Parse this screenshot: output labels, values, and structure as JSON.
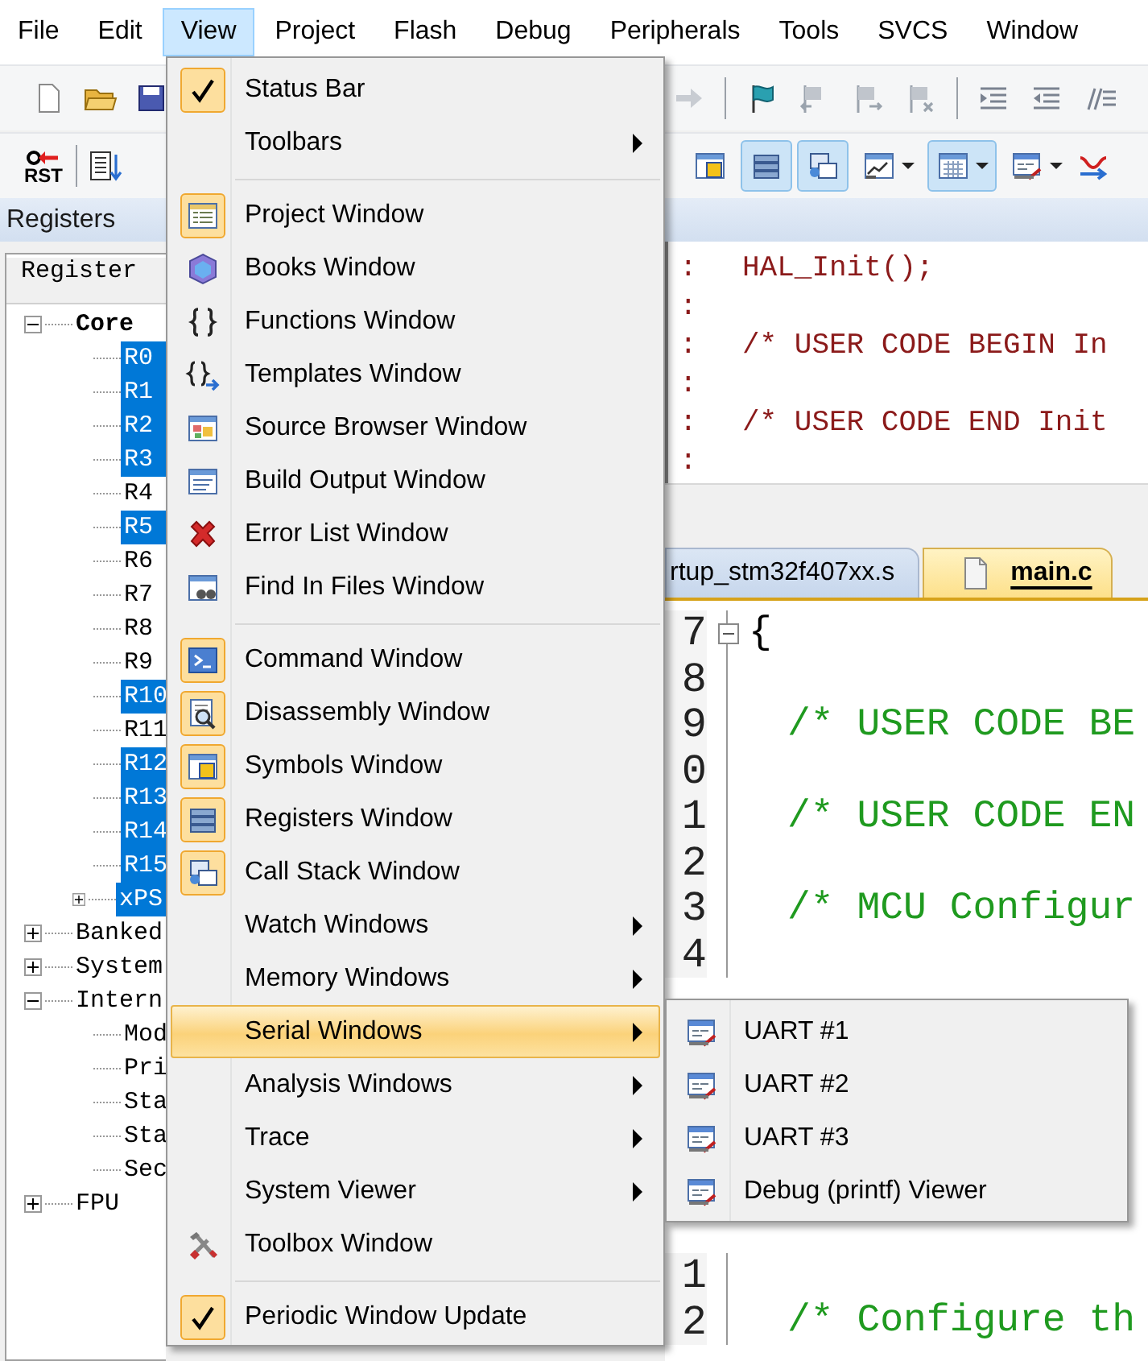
{
  "menubar": [
    {
      "label": "File",
      "selected": false
    },
    {
      "label": "Edit",
      "selected": false
    },
    {
      "label": "View",
      "selected": true
    },
    {
      "label": "Project",
      "selected": false
    },
    {
      "label": "Flash",
      "selected": false
    },
    {
      "label": "Debug",
      "selected": false
    },
    {
      "label": "Peripherals",
      "selected": false
    },
    {
      "label": "Tools",
      "selected": false
    },
    {
      "label": "SVCS",
      "selected": false
    },
    {
      "label": "Window",
      "selected": false
    }
  ],
  "debug_toolbar": {
    "reset_label": "RST",
    "buttons": [
      {
        "on": false
      },
      {
        "on": true
      },
      {
        "on": true
      },
      {
        "on": false
      },
      {
        "on": true
      },
      {
        "on": false
      }
    ]
  },
  "registers": {
    "title": "Registers",
    "column": "Register",
    "tree": [
      {
        "label": "Core",
        "bold": true,
        "expanded": true,
        "selected": false,
        "children": [
          {
            "label": "R0",
            "selected": true
          },
          {
            "label": "R1",
            "selected": true
          },
          {
            "label": "R2",
            "selected": true
          },
          {
            "label": "R3",
            "selected": true
          },
          {
            "label": "R4",
            "selected": false
          },
          {
            "label": "R5",
            "selected": true
          },
          {
            "label": "R6",
            "selected": false
          },
          {
            "label": "R7",
            "selected": false
          },
          {
            "label": "R8",
            "selected": false
          },
          {
            "label": "R9",
            "selected": false
          },
          {
            "label": "R10",
            "selected": true
          },
          {
            "label": "R11",
            "selected": false
          },
          {
            "label": "R12",
            "selected": true
          },
          {
            "label": "R13",
            "selected": true
          },
          {
            "label": "R14",
            "selected": true
          },
          {
            "label": "R15",
            "selected": true
          },
          {
            "label": "xPS",
            "expanded": false,
            "selected": true
          }
        ]
      },
      {
        "label": "Banked",
        "expanded": false,
        "selected": false
      },
      {
        "label": "System",
        "expanded": false,
        "selected": false
      },
      {
        "label": "Intern",
        "expanded": true,
        "selected": false,
        "children": [
          {
            "label": "Mod",
            "selected": false
          },
          {
            "label": "Pri",
            "selected": false
          },
          {
            "label": "Sta",
            "selected": false
          },
          {
            "label": "Sta",
            "selected": false
          },
          {
            "label": "Sec",
            "selected": false
          }
        ]
      },
      {
        "label": "FPU",
        "expanded": false,
        "selected": false
      }
    ]
  },
  "source": {
    "lines": [
      {
        "marker": ":",
        "text": "HAL_Init();"
      },
      {
        "marker": ":"
      },
      {
        "marker": ":",
        "text": "/* USER CODE BEGIN In"
      },
      {
        "marker": ":"
      },
      {
        "marker": ":",
        "text": "/* USER CODE END Init"
      },
      {
        "marker": ":"
      }
    ]
  },
  "editor": {
    "tabs": [
      {
        "label": "rtup_stm32f407xx.s",
        "selected": false
      },
      {
        "label": "main.c",
        "selected": true
      }
    ],
    "lines": [
      {
        "number": "7",
        "kind": "brace",
        "code": "{",
        "fold": true
      },
      {
        "number": "8"
      },
      {
        "number": "9",
        "kind": "comment",
        "code": "/* USER CODE BE"
      },
      {
        "number": "0"
      },
      {
        "number": "1",
        "kind": "comment",
        "code": "/* USER CODE EN"
      },
      {
        "number": "2"
      },
      {
        "number": "3",
        "kind": "comment",
        "code": "/* MCU Configur"
      },
      {
        "number": "4"
      },
      {
        "kind": "hidden"
      },
      {
        "kind": "hidden"
      },
      {
        "kind": "hidden"
      },
      {
        "kind": "hidden"
      },
      {
        "kind": "hidden"
      },
      {
        "kind": "hidden"
      },
      {
        "number": "1"
      },
      {
        "number": "2",
        "kind": "comment",
        "code": "/* Configure th"
      }
    ]
  },
  "view_menu": {
    "items": [
      {
        "kind": "check",
        "label": "Status Bar",
        "checked": true,
        "selected": false
      },
      {
        "kind": "submenu",
        "label": "Toolbars",
        "selected": false
      },
      {
        "kind": "separator"
      },
      {
        "kind": "window",
        "label": "Project Window",
        "active": true,
        "selected": false
      },
      {
        "kind": "window",
        "label": "Books Window",
        "active": false,
        "selected": false
      },
      {
        "kind": "window",
        "label": "Functions Window",
        "active": false,
        "selected": false
      },
      {
        "kind": "window",
        "label": "Templates Window",
        "active": false,
        "selected": false
      },
      {
        "kind": "window",
        "label": "Source Browser Window",
        "active": false,
        "selected": false
      },
      {
        "kind": "window",
        "label": "Build Output Window",
        "active": false,
        "selected": false
      },
      {
        "kind": "window",
        "label": "Error List Window",
        "active": false,
        "selected": false
      },
      {
        "kind": "window",
        "label": "Find In Files Window",
        "active": false,
        "selected": false
      },
      {
        "kind": "separator"
      },
      {
        "kind": "window",
        "label": "Command Window",
        "active": true,
        "selected": false
      },
      {
        "kind": "window",
        "label": "Disassembly Window",
        "active": true,
        "selected": false
      },
      {
        "kind": "window",
        "label": "Symbols Window",
        "active": true,
        "selected": false
      },
      {
        "kind": "window",
        "label": "Registers Window",
        "active": true,
        "selected": false
      },
      {
        "kind": "window",
        "label": "Call Stack Window",
        "active": true,
        "selected": false
      },
      {
        "kind": "submenu",
        "label": "Watch Windows",
        "selected": false
      },
      {
        "kind": "submenu",
        "label": "Memory Windows",
        "selected": false
      },
      {
        "kind": "submenu",
        "label": "Serial Windows",
        "selected": true
      },
      {
        "kind": "submenu",
        "label": "Analysis Windows",
        "selected": false
      },
      {
        "kind": "submenu",
        "label": "Trace",
        "selected": false
      },
      {
        "kind": "submenu",
        "label": "System Viewer",
        "selected": false
      },
      {
        "kind": "window",
        "label": "Toolbox Window",
        "active": false,
        "selected": false
      },
      {
        "kind": "separator"
      },
      {
        "kind": "check",
        "label": "Periodic Window Update",
        "checked": true,
        "selected": false
      }
    ]
  },
  "serial_menu": {
    "items": [
      {
        "label": "UART #1",
        "selected": false
      },
      {
        "label": "UART #2",
        "selected": false
      },
      {
        "label": "UART #3",
        "selected": false
      },
      {
        "label": "Debug (printf) Viewer",
        "selected": false
      }
    ]
  }
}
